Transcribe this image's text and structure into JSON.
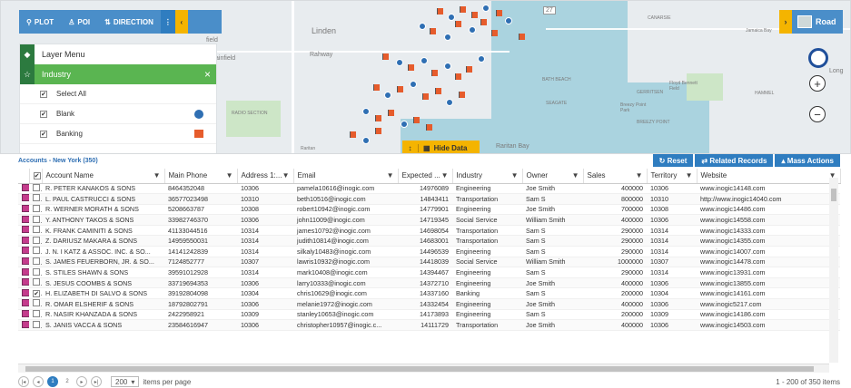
{
  "toolbar": {
    "plot": "PLOT",
    "poi": "POI",
    "direction": "DIRECTION",
    "more": "⋮",
    "collapse": "‹"
  },
  "layer_panel": {
    "menu_label": "Layer Menu",
    "industry_label": "Industry",
    "close": "×",
    "items": [
      {
        "label": "Select All",
        "checked": true
      },
      {
        "label": "Blank",
        "checked": true
      },
      {
        "label": "Banking",
        "checked": true
      }
    ]
  },
  "map": {
    "labels": [
      "Linden",
      "Rahway",
      "field",
      "ainfield",
      "RADIO SECTION",
      "Raritan Bay",
      "27",
      "CANARSIE",
      "BATH BEACH",
      "GERRITSEN",
      "SEAGATE",
      "BREEZY POINT",
      "Floyd Bennett Field",
      "Long",
      "HAMMEL",
      "Breezy Point Park",
      "Jamaica Bay",
      "Raritan"
    ],
    "hide_data": "Hide Data",
    "road_button": "Road",
    "zoom_in": "+",
    "zoom_out": "−"
  },
  "grid": {
    "title": "Accounts - New York (350)",
    "actions": [
      {
        "label": "Reset",
        "icon": "refresh-icon"
      },
      {
        "label": "Related Records",
        "icon": "swap-icon"
      },
      {
        "label": "Mass Actions",
        "icon": "caret-icon"
      }
    ],
    "columns": [
      "Account Name",
      "Main Phone",
      "Address 1:...",
      "Email",
      "Expected ...",
      "Industry",
      "Owner",
      "Sales",
      "Territory",
      "Website"
    ],
    "rows": [
      [
        "R. PETER KANAKOS & SONS",
        "8464352048",
        "10306",
        "pamela10616@inogic.com",
        "14976089",
        "Engineering",
        "Joe Smith",
        "400000",
        "10306",
        "www.inogic14148.com"
      ],
      [
        "L. PAUL CASTRUCCI & SONS",
        "36577023498",
        "10310",
        "beth10516@inogic.com",
        "14843411",
        "Transportation",
        "Sam S",
        "800000",
        "10310",
        "http://www.inogic14040.com"
      ],
      [
        "R. WERNER MORATH & SONS",
        "5208663787",
        "10308",
        "robert10942@inogic.com",
        "14779901",
        "Engineering",
        "Joe Smith",
        "700000",
        "10308",
        "www.inogic14486.com"
      ],
      [
        "Y. ANTHONY TAKOS & SONS",
        "33982746370",
        "10306",
        "john11009@inogic.com",
        "14719345",
        "Social Service",
        "William Smith",
        "400000",
        "10306",
        "www.inogic14558.com"
      ],
      [
        "K. FRANK CAMINITI & SONS",
        "41133044516",
        "10314",
        "james10792@inogic.com",
        "14698054",
        "Transportation",
        "Sam S",
        "290000",
        "10314",
        "www.inogic14333.com"
      ],
      [
        "Z. DARIUSZ MAKARA & SONS",
        "14959550031",
        "10314",
        "judith10814@inogic.com",
        "14683001",
        "Transportation",
        "Sam S",
        "290000",
        "10314",
        "www.inogic14355.com"
      ],
      [
        "J. N. I KATZ & ASSOC. INC. & SO...",
        "14141242839",
        "10314",
        "silkaly10483@inogic.com",
        "14496539",
        "Engineering",
        "Sam S",
        "290000",
        "10314",
        "www.inogic14007.com"
      ],
      [
        "S. JAMES FEUERBORN, JR. & SO...",
        "7124852777",
        "10307",
        "lawris10932@inogic.com",
        "14418039",
        "Social Service",
        "William Smith",
        "1000000",
        "10307",
        "www.inogic14478.com"
      ],
      [
        "S. STILES SHAWN & SONS",
        "39591012928",
        "10314",
        "mark10408@inogic.com",
        "14394467",
        "Engineering",
        "Sam S",
        "290000",
        "10314",
        "www.inogic13931.com"
      ],
      [
        "S. JESUS COOMBS & SONS",
        "33719694353",
        "10306",
        "larry10333@inogic.com",
        "14372710",
        "Engineering",
        "Joe Smith",
        "400000",
        "10306",
        "www.inogic13855.com"
      ],
      [
        "H. ELIZABETH DI SALVO & SONS",
        "39192804098",
        "10304",
        "chris10629@inogic.com",
        "14337160",
        "Banking",
        "Sam S",
        "200000",
        "10304",
        "www.inogic14161.com"
      ],
      [
        "R. OMAR ELSHERIF & SONS",
        "18792802791",
        "10306",
        "melanie1972@inogic.com",
        "14332454",
        "Engineering",
        "Joe Smith",
        "400000",
        "10306",
        "www.inogic5217.com"
      ],
      [
        "R. NASIR KHANZADA & SONS",
        "2422958921",
        "10309",
        "stanley10653@inogic.com",
        "14173893",
        "Engineering",
        "Sam S",
        "200000",
        "10309",
        "www.inogic14186.com"
      ],
      [
        "S. JANIS VACCA & SONS",
        "23584616947",
        "10306",
        "christopher10957@inogic.c...",
        "14111729",
        "Transportation",
        "Joe Smith",
        "400000",
        "10306",
        "www.inogic14503.com"
      ]
    ]
  },
  "pager": {
    "pages": [
      "1",
      "2"
    ],
    "per_page_value": "200",
    "per_page_label": "items per page",
    "summary": "1 - 200 of 350 items"
  }
}
